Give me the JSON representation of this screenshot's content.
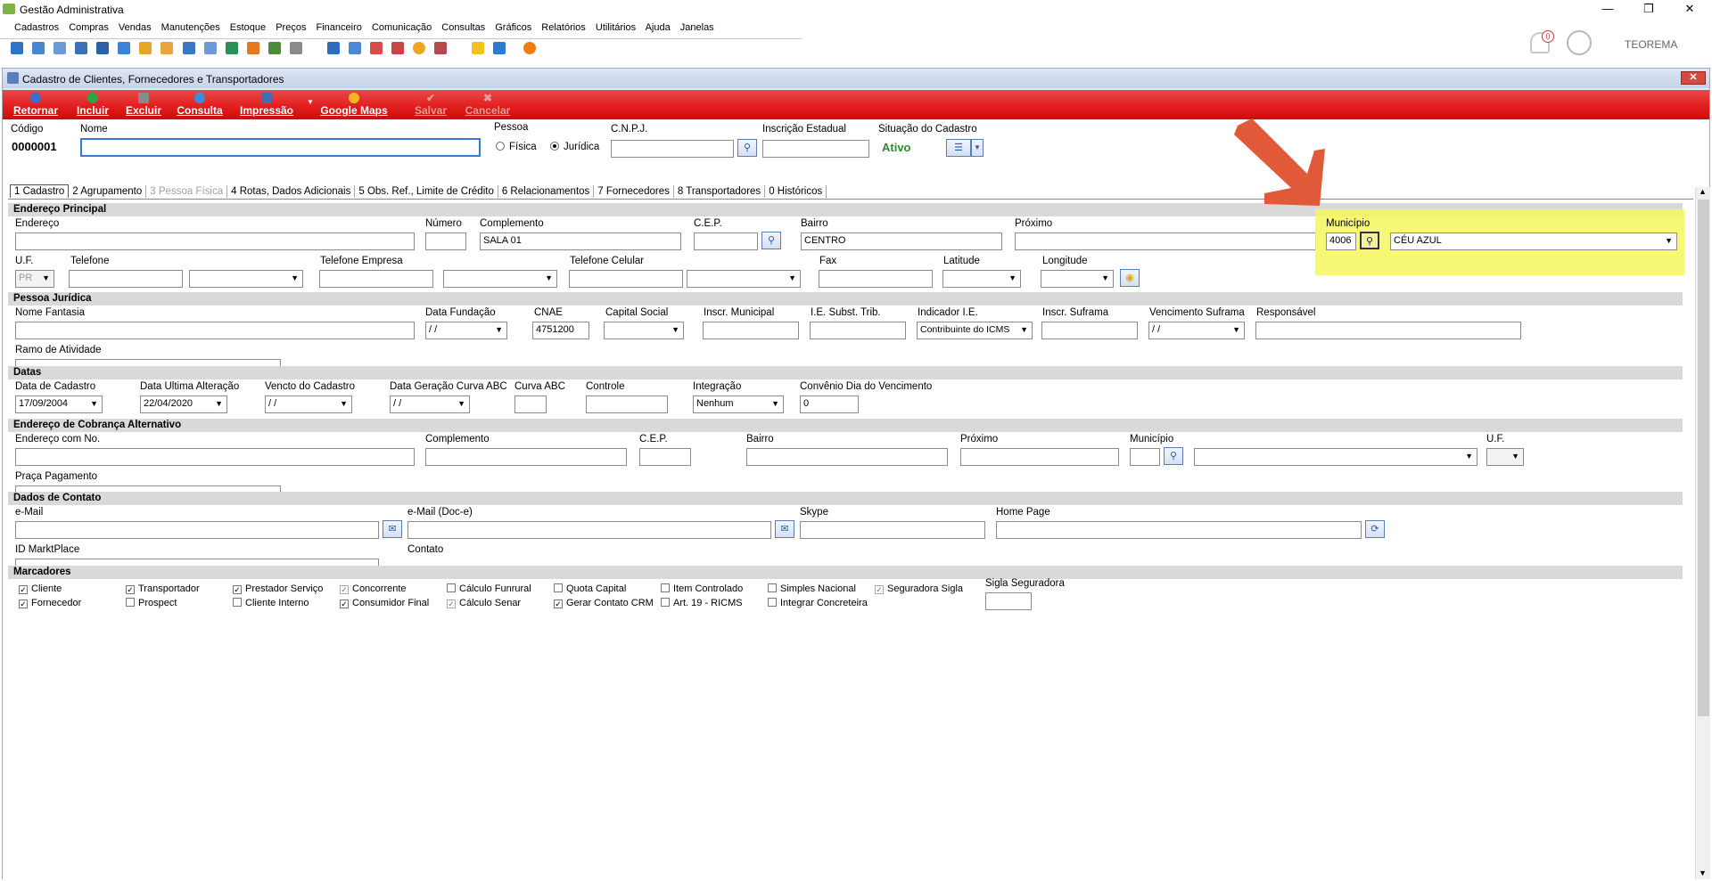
{
  "window": {
    "title": "Gestão Administrativa",
    "minimize": "—",
    "maximize": "❐",
    "close": "✕",
    "user": "TEOREMA",
    "notification_count": "0"
  },
  "menu": [
    "Cadastros",
    "Compras",
    "Vendas",
    "Manutenções",
    "Estoque",
    "Preços",
    "Financeiro",
    "Comunicação",
    "Consultas",
    "Gráficos",
    "Relatórios",
    "Utilitários",
    "Ajuda",
    "Janelas"
  ],
  "mdi": {
    "title": "Cadastro de Clientes, Fornecedores e Transportadores",
    "close": "✕"
  },
  "actions": {
    "retornar": "Retornar",
    "incluir": "Incluir",
    "excluir": "Excluir",
    "consulta": "Consulta",
    "impressao": "Impressão",
    "google_maps": "Google Maps",
    "salvar": "Salvar",
    "cancelar": "Cancelar"
  },
  "header": {
    "codigo_label": "Código",
    "codigo_value": "0000001",
    "nome_label": "Nome",
    "nome_value": "",
    "pessoa_label": "Pessoa",
    "pessoa_fisica": "Física",
    "pessoa_juridica": "Jurídica",
    "cnpj_label": "C.N.P.J.",
    "cnpj_value": "",
    "ie_label": "Inscrição Estadual",
    "ie_value": "",
    "situacao_label": "Situação do Cadastro",
    "situacao_value": "Ativo"
  },
  "tabs": [
    {
      "label": "1 Cadastro",
      "state": "active"
    },
    {
      "label": "2 Agrupamento",
      "state": "normal"
    },
    {
      "label": "3 Pessoa Física",
      "state": "disabled"
    },
    {
      "label": "4 Rotas, Dados Adicionais",
      "state": "normal"
    },
    {
      "label": "5 Obs. Ref., Limite de Crédito",
      "state": "normal"
    },
    {
      "label": "6 Relacionamentos",
      "state": "normal"
    },
    {
      "label": "7 Fornecedores",
      "state": "normal"
    },
    {
      "label": "8 Transportadores",
      "state": "normal"
    },
    {
      "label": "0 Históricos",
      "state": "normal"
    }
  ],
  "endereco_principal": {
    "section": "Endereço Principal",
    "endereco_label": "Endereço",
    "endereco_value": "",
    "numero_label": "Número",
    "numero_value": "",
    "complemento_label": "Complemento",
    "complemento_value": "SALA 01",
    "cep_label": "C.E.P.",
    "cep_value": "",
    "bairro_label": "Bairro",
    "bairro_value": "CENTRO",
    "proximo_label": "Próximo",
    "proximo_value": "",
    "municipio_label": "Município",
    "municipio_code": "4006",
    "municipio_value": "CÉU AZUL",
    "uf_label": "U.F.",
    "uf_value": "PR",
    "telefone_label": "Telefone",
    "telefone_value": "",
    "telefone_empresa_label": "Telefone Empresa",
    "telefone_celular_label": "Telefone Celular",
    "fax_label": "Fax",
    "latitude_label": "Latitude",
    "longitude_label": "Longitude"
  },
  "pessoa_juridica": {
    "section": "Pessoa Jurídica",
    "nome_fantasia_label": "Nome Fantasia",
    "nome_fantasia_value": "",
    "data_fundacao_label": "Data Fundação",
    "data_fundacao_value": " / /",
    "cnae_label": "CNAE",
    "cnae_value": "4751200",
    "capital_social_label": "Capital Social",
    "inscr_municipal_label": "Inscr. Municipal",
    "ie_subst_label": "I.E. Subst. Trib.",
    "indicador_ie_label": "Indicador I.E.",
    "indicador_ie_value": "Contribuinte do ICMS",
    "inscr_suframa_label": "Inscr. Suframa",
    "vencimento_suframa_label": "Vencimento Suframa",
    "vencimento_suframa_value": " / /",
    "responsavel_label": "Responsável",
    "ramo_label": "Ramo de Atividade"
  },
  "datas": {
    "section": "Datas",
    "data_cadastro_label": "Data de Cadastro",
    "data_cadastro_value": "17/09/2004",
    "data_alteracao_label": "Data Ultima Alteração",
    "data_alteracao_value": "22/04/2020",
    "vencto_label": "Vencto do Cadastro",
    "vencto_value": " / /",
    "curva_data_label": "Data Geração Curva ABC",
    "curva_data_value": " / /",
    "curva_label": "Curva ABC",
    "controle_label": "Controle",
    "integracao_label": "Integração",
    "integracao_value": "Nenhum",
    "convenio_label": "Convênio Dia do Vencimento",
    "convenio_value": "0"
  },
  "cobranca": {
    "section": "Endereço de Cobrança Alternativo",
    "endereco_label": "Endereço com No.",
    "complemento_label": "Complemento",
    "cep_label": "C.E.P.",
    "bairro_label": "Bairro",
    "proximo_label": "Próximo",
    "municipio_label": "Município",
    "uf_label": "U.F.",
    "praca_label": "Praça Pagamento"
  },
  "contato": {
    "section": "Dados de Contato",
    "email_label": "e-Mail",
    "email_doc_label": "e-Mail (Doc-e)",
    "skype_label": "Skype",
    "homepage_label": "Home Page",
    "id_label": "ID MarktPlace",
    "contato_label": "Contato"
  },
  "marcadores": {
    "section": "Marcadores",
    "sigla_label": "Sigla Seguradora",
    "items": [
      {
        "label": "Cliente",
        "checked": true
      },
      {
        "label": "Transportador",
        "checked": true
      },
      {
        "label": "Prestador Serviço",
        "checked": true
      },
      {
        "label": "Concorrente",
        "checked": true,
        "disabled": true
      },
      {
        "label": "Cálculo Funrural",
        "checked": false
      },
      {
        "label": "Quota Capital",
        "checked": false
      },
      {
        "label": "Item Controlado",
        "checked": false
      },
      {
        "label": "Simples Nacional",
        "checked": false
      },
      {
        "label": "Seguradora Sigla",
        "checked": true,
        "disabled": true
      },
      {
        "label": "Fornecedor",
        "checked": true
      },
      {
        "label": "Prospect",
        "checked": false
      },
      {
        "label": "Cliente Interno",
        "checked": false
      },
      {
        "label": "Consumidor Final",
        "checked": true
      },
      {
        "label": "Cálculo Senar",
        "checked": true,
        "disabled": true
      },
      {
        "label": "Gerar Contato CRM",
        "checked": true
      },
      {
        "label": "Art. 19 - RICMS",
        "checked": false
      },
      {
        "label": "Integrar Concreteira",
        "checked": false
      }
    ]
  },
  "colors": {
    "action_bar": "#e21b1b",
    "highlight": "#f4f75a",
    "arrow": "#e05a3a",
    "status_active": "#2e8b2e"
  }
}
